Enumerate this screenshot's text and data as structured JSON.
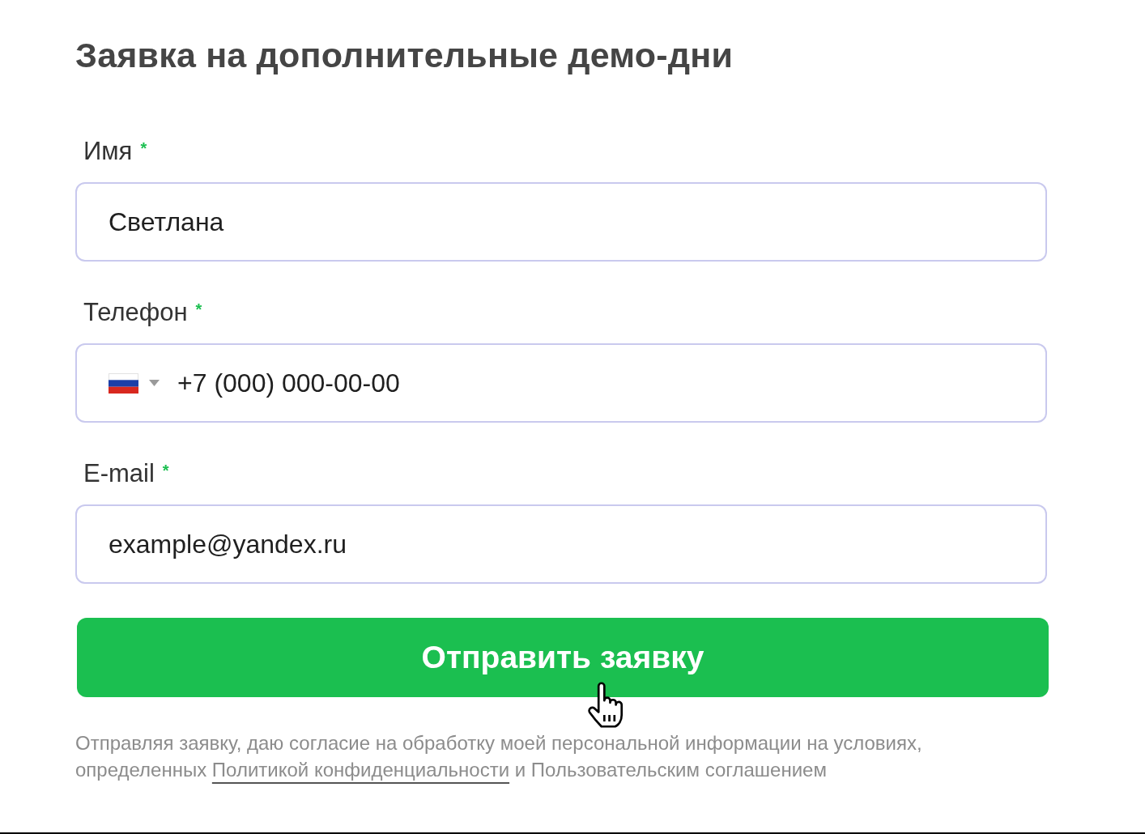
{
  "title": "Заявка на дополнительные демо-дни",
  "required_mark": "*",
  "fields": [
    {
      "kind": "text",
      "label": "Имя",
      "required": true,
      "placeholder": "Светлана"
    },
    {
      "kind": "phone",
      "label": "Телефон",
      "required": true,
      "placeholder": "+7 (000) 000-00-00"
    },
    {
      "kind": "text",
      "label": "E-mail",
      "required": true,
      "placeholder": "example@yandex.ru"
    }
  ],
  "submit": {
    "label": "Отправить заявку"
  },
  "consent": {
    "text_before": "Отправляя заявку, даю согласие на обработку моей персональной информации на условиях, определенных",
    "link": "Политикой конфиденциальности",
    "text_after": "и Пользовательским соглашением"
  }
}
